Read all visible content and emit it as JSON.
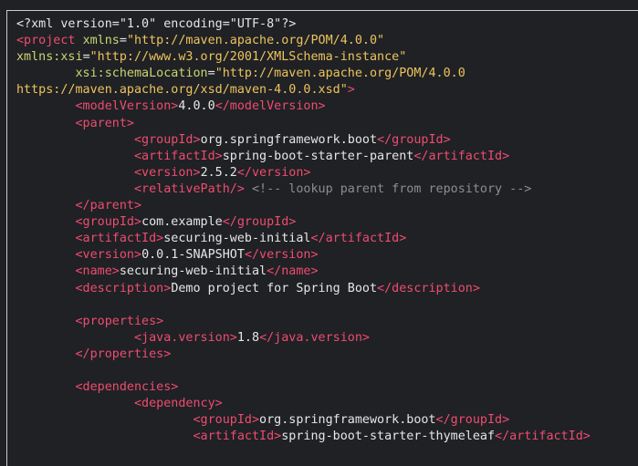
{
  "code_lines": [
    [
      [
        "x",
        "<?xml version=\"1.0\" encoding=\"UTF-8\"?>"
      ]
    ],
    [
      [
        "t",
        "<project "
      ],
      [
        "a",
        "xmlns"
      ],
      [
        "x",
        "="
      ],
      [
        "s",
        "\"http://maven.apache.org/POM/4.0.0\""
      ]
    ],
    [
      [
        "a",
        "xmlns:xsi"
      ],
      [
        "x",
        "="
      ],
      [
        "s",
        "\"http://www.w3.org/2001/XMLSchema-instance\""
      ]
    ],
    [
      [
        "x",
        "\t"
      ],
      [
        "a",
        "xsi:schemaLocation"
      ],
      [
        "x",
        "="
      ],
      [
        "s",
        "\"http://maven.apache.org/POM/4.0.0"
      ]
    ],
    [
      [
        "s",
        "https://maven.apache.org/xsd/maven-4.0.0.xsd\""
      ],
      [
        "t",
        ">"
      ]
    ],
    [
      [
        "x",
        "\t"
      ],
      [
        "t",
        "<modelVersion>"
      ],
      [
        "x",
        "4.0.0"
      ],
      [
        "t",
        "</modelVersion>"
      ]
    ],
    [
      [
        "x",
        "\t"
      ],
      [
        "t",
        "<parent>"
      ]
    ],
    [
      [
        "x",
        "\t\t"
      ],
      [
        "t",
        "<groupId>"
      ],
      [
        "x",
        "org.springframework.boot"
      ],
      [
        "t",
        "</groupId>"
      ]
    ],
    [
      [
        "x",
        "\t\t"
      ],
      [
        "t",
        "<artifactId>"
      ],
      [
        "x",
        "spring-boot-starter-parent"
      ],
      [
        "t",
        "</artifactId>"
      ]
    ],
    [
      [
        "x",
        "\t\t"
      ],
      [
        "t",
        "<version>"
      ],
      [
        "x",
        "2.5.2"
      ],
      [
        "t",
        "</version>"
      ]
    ],
    [
      [
        "x",
        "\t\t"
      ],
      [
        "t",
        "<relativePath/>"
      ],
      [
        "x",
        " "
      ],
      [
        "c",
        "<!-- lookup parent from repository -->"
      ]
    ],
    [
      [
        "x",
        "\t"
      ],
      [
        "t",
        "</parent>"
      ]
    ],
    [
      [
        "x",
        "\t"
      ],
      [
        "t",
        "<groupId>"
      ],
      [
        "x",
        "com.example"
      ],
      [
        "t",
        "</groupId>"
      ]
    ],
    [
      [
        "x",
        "\t"
      ],
      [
        "t",
        "<artifactId>"
      ],
      [
        "x",
        "securing-web-initial"
      ],
      [
        "t",
        "</artifactId>"
      ]
    ],
    [
      [
        "x",
        "\t"
      ],
      [
        "t",
        "<version>"
      ],
      [
        "x",
        "0.0.1-SNAPSHOT"
      ],
      [
        "t",
        "</version>"
      ]
    ],
    [
      [
        "x",
        "\t"
      ],
      [
        "t",
        "<name>"
      ],
      [
        "x",
        "securing-web-initial"
      ],
      [
        "t",
        "</name>"
      ]
    ],
    [
      [
        "x",
        "\t"
      ],
      [
        "t",
        "<description>"
      ],
      [
        "x",
        "Demo project for Spring Boot"
      ],
      [
        "t",
        "</description>"
      ]
    ],
    [
      [
        "x",
        ""
      ]
    ],
    [
      [
        "x",
        "\t"
      ],
      [
        "t",
        "<properties>"
      ]
    ],
    [
      [
        "x",
        "\t\t"
      ],
      [
        "t",
        "<java.version>"
      ],
      [
        "x",
        "1.8"
      ],
      [
        "t",
        "</java.version>"
      ]
    ],
    [
      [
        "x",
        "\t"
      ],
      [
        "t",
        "</properties>"
      ]
    ],
    [
      [
        "x",
        ""
      ]
    ],
    [
      [
        "x",
        "\t"
      ],
      [
        "t",
        "<dependencies>"
      ]
    ],
    [
      [
        "x",
        "\t\t"
      ],
      [
        "t",
        "<dependency>"
      ]
    ],
    [
      [
        "x",
        "\t\t\t"
      ],
      [
        "t",
        "<groupId>"
      ],
      [
        "x",
        "org.springframework.boot"
      ],
      [
        "t",
        "</groupId>"
      ]
    ],
    [
      [
        "x",
        "\t\t\t"
      ],
      [
        "t",
        "<artifactId>"
      ],
      [
        "x",
        "spring-boot-starter-thymeleaf"
      ],
      [
        "t",
        "</artifactId>"
      ]
    ]
  ]
}
